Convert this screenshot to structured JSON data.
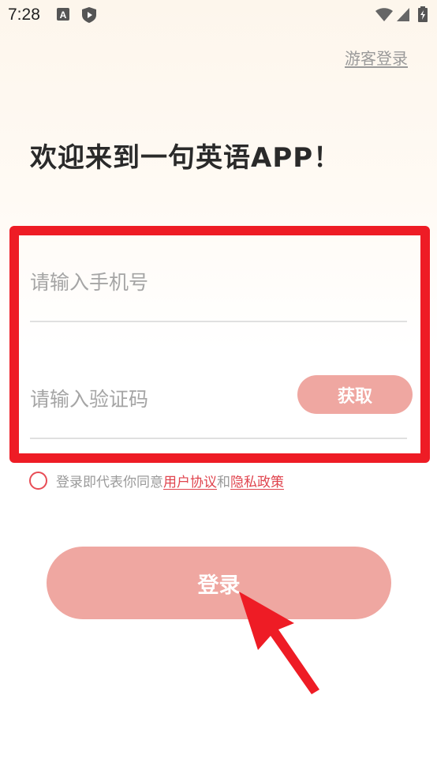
{
  "status_bar": {
    "time": "7:28",
    "icons": [
      "a-icon",
      "shield-play-icon",
      "wifi-icon",
      "signal-icon",
      "battery-icon"
    ]
  },
  "header": {
    "guest_login": "游客登录"
  },
  "welcome": {
    "title": "欢迎来到一句英语APP！"
  },
  "form": {
    "phone_placeholder": "请输入手机号",
    "code_placeholder": "请输入验证码",
    "get_code_label": "获取"
  },
  "agreement": {
    "prefix": "登录即代表你同意",
    "user_agreement": "用户协议",
    "conjunction": "和",
    "privacy_policy": "隐私政策"
  },
  "login": {
    "button_label": "登录"
  },
  "colors": {
    "accent": "#efa7a1",
    "highlight_red": "#ee1c25",
    "link_red": "#e0444e"
  }
}
